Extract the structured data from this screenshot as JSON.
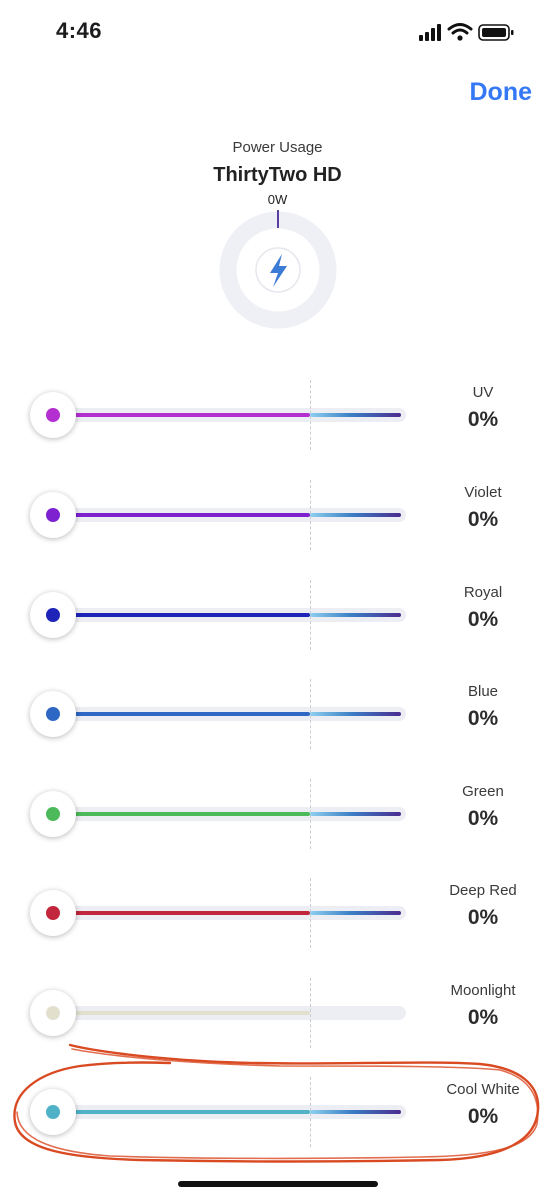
{
  "status_bar": {
    "time": "4:46",
    "icons": [
      "cellular-signal-icon",
      "wifi-icon",
      "battery-icon"
    ]
  },
  "header": {
    "done_label": "Done",
    "accent_color": "#3478f6"
  },
  "power": {
    "label": "Power Usage",
    "device_name": "ThirtyTwo HD",
    "watts": "0W",
    "icon": "lightning-bolt-icon"
  },
  "channels": [
    {
      "name": "UV",
      "value": "0%",
      "color": "#b32fd0"
    },
    {
      "name": "Violet",
      "value": "0%",
      "color": "#7e21cf"
    },
    {
      "name": "Royal",
      "value": "0%",
      "color": "#1e24b8"
    },
    {
      "name": "Blue",
      "value": "0%",
      "color": "#2f68c4"
    },
    {
      "name": "Green",
      "value": "0%",
      "color": "#4cb95b"
    },
    {
      "name": "Deep Red",
      "value": "0%",
      "color": "#c1263c"
    },
    {
      "name": "Moonlight",
      "value": "0%",
      "color": "#e2e0cd"
    },
    {
      "name": "Cool White",
      "value": "0%",
      "color": "#4fb2c6"
    }
  ],
  "annotation": {
    "color": "#d94a22",
    "highlights": "Cool White"
  }
}
